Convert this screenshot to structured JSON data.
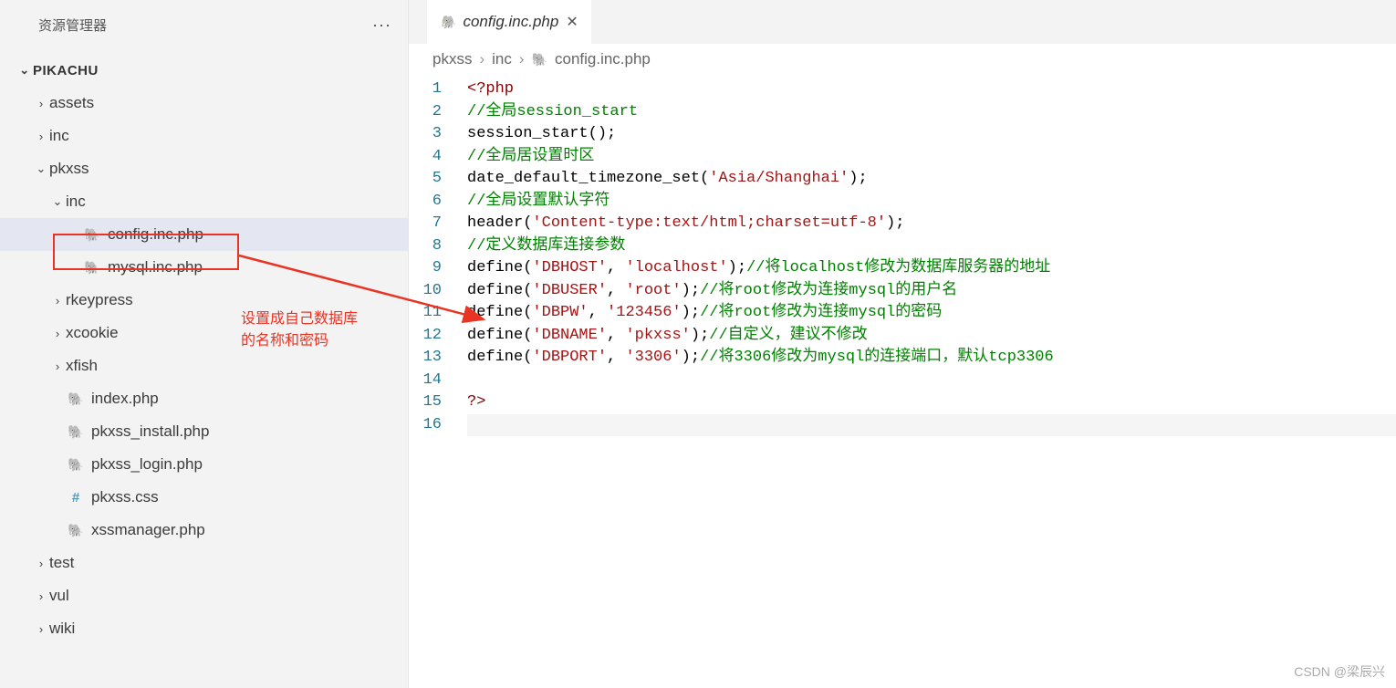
{
  "sidebar": {
    "title": "资源管理器",
    "root": "PIKACHU",
    "items": [
      {
        "label": "assets",
        "type": "folder",
        "depth": 1,
        "expanded": false
      },
      {
        "label": "inc",
        "type": "folder",
        "depth": 1,
        "expanded": false
      },
      {
        "label": "pkxss",
        "type": "folder",
        "depth": 1,
        "expanded": true
      },
      {
        "label": "inc",
        "type": "folder",
        "depth": 2,
        "expanded": true
      },
      {
        "label": "config.inc.php",
        "type": "php",
        "depth": 3,
        "selected": true
      },
      {
        "label": "mysql.inc.php",
        "type": "php",
        "depth": 3
      },
      {
        "label": "rkeypress",
        "type": "folder",
        "depth": 2,
        "expanded": false
      },
      {
        "label": "xcookie",
        "type": "folder",
        "depth": 2,
        "expanded": false
      },
      {
        "label": "xfish",
        "type": "folder",
        "depth": 2,
        "expanded": false
      },
      {
        "label": "index.php",
        "type": "php",
        "depth": 2
      },
      {
        "label": "pkxss_install.php",
        "type": "php",
        "depth": 2
      },
      {
        "label": "pkxss_login.php",
        "type": "php",
        "depth": 2
      },
      {
        "label": "pkxss.css",
        "type": "css",
        "depth": 2
      },
      {
        "label": "xssmanager.php",
        "type": "php",
        "depth": 2
      },
      {
        "label": "test",
        "type": "folder",
        "depth": 1,
        "expanded": false
      },
      {
        "label": "vul",
        "type": "folder",
        "depth": 1,
        "expanded": false
      },
      {
        "label": "wiki",
        "type": "folder",
        "depth": 1,
        "expanded": false
      }
    ]
  },
  "annotation": {
    "line1": "设置成自己数据库",
    "line2": "的名称和密码"
  },
  "tab": {
    "label": "config.inc.php"
  },
  "breadcrumbs": {
    "p1": "pkxss",
    "p2": "inc",
    "p3": "config.inc.php"
  },
  "code": {
    "l1": {
      "a": "<?php"
    },
    "l2": {
      "a": "//全局session_start"
    },
    "l3": {
      "a": "session_start",
      "b": "();"
    },
    "l4": {
      "a": "//全局居设置时区"
    },
    "l5": {
      "a": "date_default_timezone_set",
      "b": "(",
      "c": "'Asia/Shanghai'",
      "d": ");"
    },
    "l6": {
      "a": "//全局设置默认字符"
    },
    "l7": {
      "a": "header",
      "b": "(",
      "c": "'Content-type:text/html;charset=utf-8'",
      "d": ");"
    },
    "l8": {
      "a": "//定义数据库连接参数"
    },
    "l9": {
      "a": "define",
      "b": "(",
      "c": "'DBHOST'",
      "d": ", ",
      "e": "'localhost'",
      "f": ");",
      "g": "//将localhost修改为数据库服务器的地址"
    },
    "l10": {
      "a": "define",
      "b": "(",
      "c": "'DBUSER'",
      "d": ", ",
      "e": "'root'",
      "f": ");",
      "g": "//将root修改为连接mysql的用户名"
    },
    "l11": {
      "a": "define",
      "b": "(",
      "c": "'DBPW'",
      "d": ", ",
      "e": "'123456'",
      "f": ");",
      "g": "//将root修改为连接mysql的密码"
    },
    "l12": {
      "a": "define",
      "b": "(",
      "c": "'DBNAME'",
      "d": ", ",
      "e": "'pkxss'",
      "f": ");",
      "g": "//自定义，建议不修改"
    },
    "l13": {
      "a": "define",
      "b": "(",
      "c": "'DBPORT'",
      "d": ", ",
      "e": "'3306'",
      "f": ");",
      "g": "//将3306修改为mysql的连接端口，默认tcp3306"
    },
    "l15": {
      "a": "?>"
    }
  },
  "watermark": "CSDN @梁辰兴"
}
